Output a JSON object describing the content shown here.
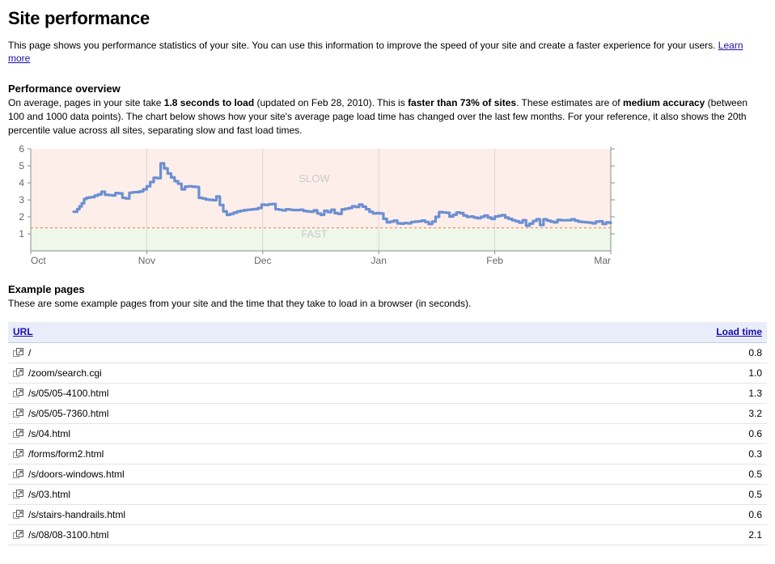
{
  "header": {
    "title": "Site performance",
    "intro_before_link": "This page shows you performance statistics of your site. You can use this information to improve the speed of your site and create a faster experience for your users. ",
    "learn_more": "Learn more"
  },
  "overview": {
    "heading": "Performance overview",
    "t1": "On average, pages in your site take ",
    "b1": "1.8 seconds to load",
    "t2": " (updated on Feb 28, 2010). This is ",
    "b2": "faster than 73% of sites",
    "t3": ". These estimates are of ",
    "b3": "medium accuracy",
    "t4": " (between 100 and 1000 data points). The chart below shows how your site's average page load time has changed over the last few months. For your reference, it also shows the 20th percentile value across all sites, separating slow and fast load times."
  },
  "example_pages": {
    "heading": "Example pages",
    "description": "These are some example pages from your site and the time that they take to load in a browser (in seconds).",
    "columns": {
      "url": "URL",
      "load_time": "Load time"
    },
    "rows": [
      {
        "icon": "external-link-icon",
        "url": "/",
        "load_time": "0.8"
      },
      {
        "icon": "external-link-icon",
        "url": "/zoom/search.cgi",
        "load_time": "1.0"
      },
      {
        "icon": "external-link-icon",
        "url": "/s/05/05-4100.html",
        "load_time": "1.3"
      },
      {
        "icon": "external-link-icon",
        "url": "/s/05/05-7360.html",
        "load_time": "3.2"
      },
      {
        "icon": "external-link-icon",
        "url": "/s/04.html",
        "load_time": "0.6"
      },
      {
        "icon": "external-link-icon",
        "url": "/forms/form2.html",
        "load_time": "0.3"
      },
      {
        "icon": "external-link-icon",
        "url": "/s/doors-windows.html",
        "load_time": "0.5"
      },
      {
        "icon": "external-link-icon",
        "url": "/s/03.html",
        "load_time": "0.5"
      },
      {
        "icon": "external-link-icon",
        "url": "/s/stairs-handrails.html",
        "load_time": "0.6"
      },
      {
        "icon": "external-link-icon",
        "url": "/s/08/08-3100.html",
        "load_time": "2.1"
      }
    ]
  },
  "chart_data": {
    "type": "line",
    "title": "",
    "xlabel": "",
    "ylabel": "",
    "ylim": [
      0,
      6
    ],
    "yticks": [
      1,
      2,
      3,
      4,
      5,
      6
    ],
    "xtick_labels": [
      "Oct",
      "Nov",
      "Dec",
      "Jan",
      "Feb",
      "Mar"
    ],
    "grid": "vertical-month-lines",
    "legend": "none",
    "zones": [
      {
        "label": "SLOW",
        "from": 1.35,
        "to": 6,
        "color": "#fdeee9"
      },
      {
        "label": "FAST",
        "from": 0,
        "to": 1.35,
        "color": "#eef7ea"
      }
    ],
    "threshold": {
      "value": 1.35,
      "style": "dashed",
      "color": "#e8823c",
      "description": "20th percentile across all sites"
    },
    "series": [
      {
        "name": "Average page load time",
        "color": "#6b8fd4",
        "x": [
          0.37,
          0.4,
          0.42,
          0.44,
          0.46,
          0.48,
          0.5,
          0.52,
          0.55,
          0.58,
          0.61,
          0.64,
          0.67,
          0.7,
          0.73,
          0.76,
          0.79,
          0.82,
          0.85,
          0.88,
          0.91,
          0.94,
          0.97,
          1.0,
          1.03,
          1.06,
          1.09,
          1.12,
          1.15,
          1.18,
          1.21,
          1.24,
          1.27,
          1.3,
          1.33,
          1.36,
          1.39,
          1.42,
          1.45,
          1.48,
          1.51,
          1.54,
          1.57,
          1.6,
          1.63,
          1.66,
          1.69,
          1.72,
          1.75,
          1.78,
          1.81,
          1.84,
          1.87,
          1.9,
          1.93,
          1.96,
          1.99,
          2.02,
          2.05,
          2.08,
          2.11,
          2.14,
          2.17,
          2.2,
          2.23,
          2.26,
          2.29,
          2.32,
          2.35,
          2.38,
          2.41,
          2.44,
          2.47,
          2.5,
          2.53,
          2.56,
          2.59,
          2.62,
          2.65,
          2.68,
          2.71,
          2.74,
          2.77,
          2.8,
          2.83,
          2.86,
          2.89,
          2.92,
          2.95,
          2.98,
          3.01,
          3.04,
          3.07,
          3.1,
          3.13,
          3.16,
          3.19,
          3.22,
          3.25,
          3.28,
          3.31,
          3.34,
          3.37,
          3.4,
          3.43,
          3.46,
          3.49,
          3.52,
          3.55,
          3.58,
          3.61,
          3.64,
          3.67,
          3.7,
          3.73,
          3.76,
          3.79,
          3.82,
          3.85,
          3.88,
          3.91,
          3.94,
          3.97,
          4.0,
          4.03,
          4.06,
          4.09,
          4.12,
          4.15,
          4.18,
          4.21,
          4.24,
          4.27,
          4.3,
          4.33,
          4.36,
          4.39,
          4.42,
          4.45,
          4.48,
          4.51,
          4.54,
          4.57,
          4.6,
          4.63,
          4.66,
          4.69,
          4.72,
          4.75,
          4.78,
          4.81,
          4.84,
          4.87,
          4.9,
          4.93,
          4.96,
          4.99,
          5.0
        ],
        "y": [
          2.3,
          2.45,
          2.62,
          2.8,
          3.05,
          3.12,
          3.14,
          3.16,
          3.25,
          3.32,
          3.48,
          3.3,
          3.28,
          3.26,
          3.4,
          3.38,
          3.12,
          3.08,
          3.42,
          3.45,
          3.46,
          3.5,
          3.62,
          3.8,
          4.05,
          4.3,
          4.28,
          5.15,
          4.85,
          4.55,
          4.32,
          4.1,
          3.95,
          3.62,
          3.78,
          3.8,
          3.78,
          3.76,
          3.12,
          3.08,
          3.02,
          3.0,
          2.98,
          3.2,
          2.7,
          2.32,
          2.12,
          2.18,
          2.25,
          2.32,
          2.36,
          2.4,
          2.42,
          2.44,
          2.46,
          2.52,
          2.72,
          2.7,
          2.74,
          2.76,
          2.45,
          2.42,
          2.38,
          2.45,
          2.42,
          2.4,
          2.4,
          2.42,
          2.35,
          2.32,
          2.3,
          2.38,
          2.2,
          2.12,
          2.36,
          2.28,
          2.42,
          2.22,
          2.18,
          2.44,
          2.48,
          2.52,
          2.62,
          2.58,
          2.72,
          2.6,
          2.45,
          2.3,
          2.2,
          2.22,
          2.2,
          1.88,
          1.68,
          1.72,
          1.78,
          1.62,
          1.6,
          1.64,
          1.62,
          1.7,
          1.72,
          1.74,
          1.78,
          1.7,
          1.58,
          1.72,
          2.0,
          2.28,
          2.26,
          2.24,
          2.02,
          2.12,
          2.26,
          2.22,
          2.08,
          2.0,
          2.02,
          1.96,
          1.92,
          2.0,
          2.08,
          1.96,
          1.88,
          2.02,
          2.06,
          2.1,
          1.96,
          1.88,
          1.8,
          1.74,
          1.66,
          1.8,
          1.48,
          1.6,
          1.76,
          1.86,
          1.52,
          1.86,
          1.78,
          1.72,
          1.68,
          1.82,
          1.8,
          1.8,
          1.8,
          1.86,
          1.78,
          1.72,
          1.7,
          1.68,
          1.66,
          1.62,
          1.72,
          1.74,
          1.58,
          1.68,
          1.64,
          1.66
        ]
      }
    ]
  }
}
